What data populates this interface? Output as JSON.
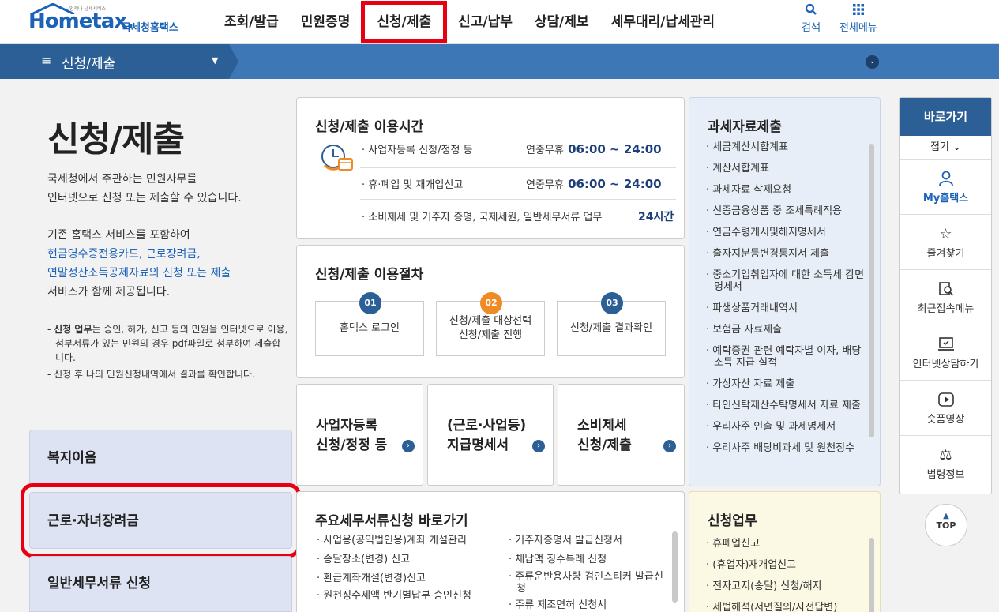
{
  "header": {
    "logo_text": "Hometax.",
    "logo_tagline": "언제나 납세서비스",
    "logo_sub": "국세청홈택스",
    "nav": [
      "조회/발급",
      "민원증명",
      "신청/제출",
      "신고/납부",
      "상담/제보",
      "세무대리/납세관리"
    ],
    "search_label": "검색",
    "allmenu_label": "전체메뉴"
  },
  "subbar": {
    "title": "신청/제출"
  },
  "intro": {
    "title": "신청/제출",
    "p1": [
      "국세청에서 주관하는 민원사무를",
      "인터넷으로 신청 또는 제출할 수 있습니다."
    ],
    "p2_line1": "기존 홈택스 서비스를 포함하여",
    "p2_link1": "현금영수증전용카드, 근로장려금,",
    "p2_link2": "연말정산소득공제자료의 신청 또는 제출",
    "p2_line4": "서비스가 함께 제공됩니다.",
    "note1_bold": "신청 업무",
    "note1_rest": "는 승인, 허가, 신고 등의 민원을 인터넷으로 이용, 첨부서류가 있는 민원의 경우 pdf파일로 첨부하여 제출합니다.",
    "note2": "신청 후 나의 민원신청내역에서 결과를 확인합니다."
  },
  "left_menu": [
    "복지이음",
    "근로·자녀장려금",
    "일반세무서류 신청"
  ],
  "hours": {
    "title": "신청/제출 이용시간",
    "rows": [
      {
        "label": "· 사업자등록 신청/정정 등",
        "pre": "연중무휴",
        "time": "06:00 ~ 24:00"
      },
      {
        "label": "· 휴·폐업 및 재개업신고",
        "pre": "연중무휴",
        "time": "06:00 ~ 24:00"
      },
      {
        "label": "· 소비제세 및 거주자 증명, 국제세원, 일반세무서류 업무",
        "pre": "",
        "time": "24시간"
      }
    ]
  },
  "procedure": {
    "title": "신청/제출 이용절차",
    "steps": [
      {
        "num": "01",
        "label": "홈택스 로그인",
        "color": "#2c5f96"
      },
      {
        "num": "02",
        "label": "신청/제출 대상선택\n신청/제출 진행",
        "color": "#f08a24"
      },
      {
        "num": "03",
        "label": "신청/제출 결과확인",
        "color": "#2c5f96"
      }
    ]
  },
  "quick_cards": [
    {
      "l1": "사업자등록",
      "l2": "신청/정정 등"
    },
    {
      "l1": "(근로·사업등)",
      "l2": "지급명세서"
    },
    {
      "l1": "소비제세",
      "l2": "신청/제출"
    }
  ],
  "docs": {
    "title": "주요세무서류신청 바로가기",
    "col1": [
      "사업용(공익법인용)계좌 개설관리",
      "송달장소(변경) 신고",
      "환급계좌개설(변경)신고",
      "원천징수세액 반기별납부 승인신청"
    ],
    "col2": [
      "거주자증명서 발급신청서",
      "체납액 징수특례 신청",
      "주류운반용차량 검인스티커 발급신청",
      "주류 제조면허 신청서"
    ]
  },
  "taxdata": {
    "title": "과세자료제출",
    "items": [
      "세금계산서합계표",
      "계산서합계표",
      "과세자료 삭제요청",
      "신종금융상품 중 조세특례적용",
      "연금수령개시및해지명세서",
      "출자지분등변경통지서 제출",
      "중소기업취업자에 대한 소득세 감면명세서",
      "파생상품거래내역서",
      "보험금 자료제출",
      "예탁증권 관련 예탁자별 이자, 배당소득 지급 실적",
      "가상자산 자료 제출",
      "타인신탁재산수탁명세서 자료 제출",
      "우리사주 인출 및 과세명세서",
      "우리사주 배당비과세 및 원천징수"
    ]
  },
  "apply": {
    "title": "신청업무",
    "items": [
      "휴폐업신고",
      "(휴업자)재개업신고",
      "전자고지(송달) 신청/해지",
      "세법해석(서면질의/사전답변)"
    ]
  },
  "quickbar": {
    "head": "바로가기",
    "fold": "접기",
    "items": [
      {
        "icon": "person-icon",
        "glyph": "♙",
        "label": "My홈택스"
      },
      {
        "icon": "star-icon",
        "glyph": "☆",
        "label": "즐겨찾기"
      },
      {
        "icon": "recent-search-icon",
        "glyph": "⌕",
        "label": "최근접속메뉴"
      },
      {
        "icon": "monitor-icon",
        "glyph": "▭",
        "label": "인터넷상담하기"
      },
      {
        "icon": "play-icon",
        "glyph": "▶",
        "label": "숏폼영상"
      },
      {
        "icon": "gavel-icon",
        "glyph": "⚖",
        "label": "법령정보"
      }
    ],
    "top_label": "TOP"
  }
}
